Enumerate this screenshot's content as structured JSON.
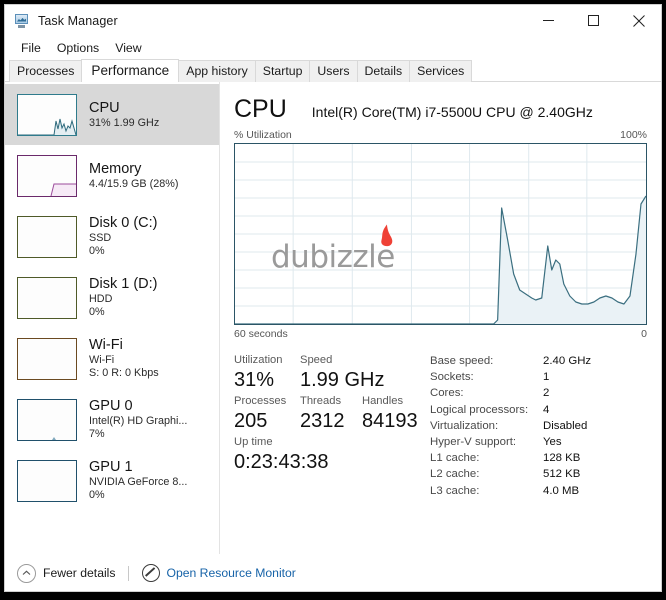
{
  "window": {
    "title": "Task Manager",
    "icon": "task-manager-icon",
    "controls": {
      "minimize": "–",
      "maximize": "□",
      "close": "✕"
    }
  },
  "menu": {
    "items": [
      "File",
      "Options",
      "View"
    ]
  },
  "tabs": {
    "items": [
      "Processes",
      "Performance",
      "App history",
      "Startup",
      "Users",
      "Details",
      "Services"
    ],
    "active": "Performance"
  },
  "sidebar": {
    "items": [
      {
        "name": "CPU",
        "sub1": "31%  1.99 GHz",
        "sub2": "",
        "selected": true,
        "color": "#2f7b8c"
      },
      {
        "name": "Memory",
        "sub1": "4.4/15.9 GB (28%)",
        "sub2": "",
        "selected": false,
        "color": "#6b2a6b"
      },
      {
        "name": "Disk 0 (C:)",
        "sub1": "SSD",
        "sub2": "0%",
        "selected": false,
        "color": "#4f5a28"
      },
      {
        "name": "Disk 1 (D:)",
        "sub1": "HDD",
        "sub2": "0%",
        "selected": false,
        "color": "#4f5a28"
      },
      {
        "name": "Wi-Fi",
        "sub1": "Wi-Fi",
        "sub2": "S: 0 R: 0 Kbps",
        "selected": false,
        "color": "#6b4a21"
      },
      {
        "name": "GPU 0",
        "sub1": "Intel(R) HD Graphi...",
        "sub2": "7%",
        "selected": false,
        "color": "#20506b"
      },
      {
        "name": "GPU 1",
        "sub1": "NVIDIA GeForce 8...",
        "sub2": "0%",
        "selected": false,
        "color": "#20506b"
      }
    ]
  },
  "main": {
    "title": "CPU",
    "model": "Intel(R) Core(TM) i7-5500U CPU @ 2.40GHz",
    "graph_axis_label": "% Utilization",
    "graph_max": "100%",
    "time_left": "60 seconds",
    "time_right": "0",
    "watermark": "dubizzle"
  },
  "stats": {
    "row1": [
      {
        "label": "Utilization",
        "value": "31%"
      },
      {
        "label": "Speed",
        "value": "1.99 GHz"
      }
    ],
    "row2": [
      {
        "label": "Processes",
        "value": "205"
      },
      {
        "label": "Threads",
        "value": "2312"
      },
      {
        "label": "Handles",
        "value": "84193"
      }
    ],
    "row3": [
      {
        "label": "Up time",
        "value": "0:23:43:38"
      }
    ]
  },
  "specs": [
    {
      "key": "Base speed:",
      "value": "2.40 GHz"
    },
    {
      "key": "Sockets:",
      "value": "1"
    },
    {
      "key": "Cores:",
      "value": "2"
    },
    {
      "key": "Logical processors:",
      "value": "4"
    },
    {
      "key": "Virtualization:",
      "value": "Disabled"
    },
    {
      "key": "Hyper-V support:",
      "value": "Yes"
    },
    {
      "key": "L1 cache:",
      "value": "128 KB"
    },
    {
      "key": "L2 cache:",
      "value": "512 KB"
    },
    {
      "key": "L3 cache:",
      "value": "4.0 MB"
    }
  ],
  "footer": {
    "fewer_details": "Fewer details",
    "resource_monitor": "Open Resource Monitor"
  },
  "chart_data": {
    "type": "area",
    "title": "CPU % Utilization",
    "xlabel": "",
    "ylabel": "% Utilization",
    "xlim": [
      60,
      0
    ],
    "ylim": [
      0,
      100
    ],
    "grid": true,
    "legend": null,
    "x_tick_labels": [
      "60 seconds",
      "0"
    ],
    "y_tick_labels": [
      "100%"
    ],
    "line_color": "#2f6b7d",
    "fill_color": "#e8f0f4",
    "series": [
      {
        "name": "CPU utilization",
        "x": [
          60,
          45,
          30,
          22,
          20,
          18.5,
          17.5,
          16.5,
          15.5,
          14.5,
          13.5,
          12.5,
          11.5,
          10.5,
          9.5,
          8.5,
          7.5,
          6.5,
          5.5,
          4.5,
          3.5,
          2.5,
          1.5,
          0.8,
          0
        ],
        "values": [
          0,
          0,
          0,
          0,
          2,
          62,
          40,
          22,
          12,
          10,
          9,
          28,
          14,
          22,
          20,
          10,
          6,
          5,
          5,
          8,
          9,
          6,
          5,
          30,
          66
        ]
      }
    ]
  }
}
